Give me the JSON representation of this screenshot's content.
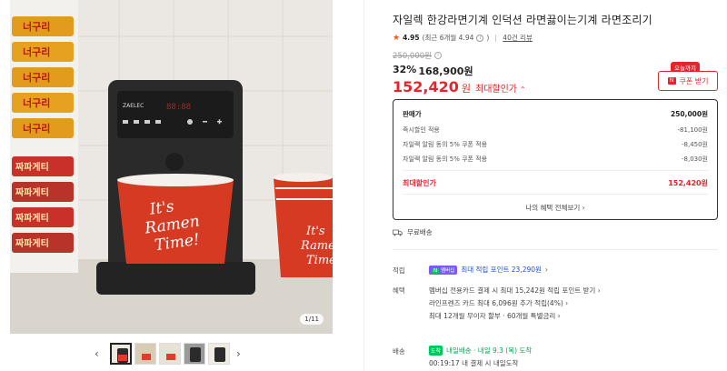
{
  "gallery": {
    "counter": "1/11",
    "prev_icon": "‹",
    "next_icon": "›",
    "thumbnail_count": 5,
    "image": {
      "noodle_brand_1": "너구리",
      "noodle_brand_2": "짜파게티",
      "machine_brand": "ZAELEC",
      "cup_text_1": "It's",
      "cup_text_2": "Ramen",
      "cup_text_3": "Time!"
    }
  },
  "product": {
    "title": "자일렉 한강라면기계 인덕션 라면끓이는기계 라면조리기",
    "rating": "4.95",
    "rating_detail": "(최근 6개월 4.94",
    "review_link": "40건 리뷰",
    "original_price": "250,000원",
    "discount_rate": "32%",
    "sale_price": "168,900원",
    "max_price": "152,420",
    "max_unit": "원",
    "max_label": "최대할인가",
    "coupon_badge": "오늘까지",
    "coupon_button": "쿠폰 받기"
  },
  "price_box": {
    "rows": [
      {
        "label": "판매가",
        "value": "250,000원"
      },
      {
        "label": "즉시할인 적용",
        "value": "-81,100원"
      },
      {
        "label": "자일렉 알림 동의 5% 쿠폰 적용",
        "value": "-8,450원"
      },
      {
        "label": "자일렉 알림 동의 5% 쿠폰 적용",
        "value": "-8,030원"
      }
    ],
    "max_label": "최대할인가",
    "max_value": "152,420원",
    "all_benefits": "나의 혜택 전체보기"
  },
  "shipping": "무료배송",
  "points": {
    "label": "적립",
    "badge": "멤버십",
    "text": "최대 적립 포인트 23,290원"
  },
  "benefits": {
    "label": "혜택",
    "lines": [
      "멤버십 전용카드 결제 시 최대 15,242원 적립 포인트 받기",
      "라인프렌즈 카드 최대 6,096원 추가 적립(4%)",
      "최대 12개월 무이자 할부 · 60개월 특별금리"
    ]
  },
  "delivery": {
    "label": "배송",
    "badge": "도착",
    "text": "내일배송 · 내일 9.3 (목) 도착",
    "detail": "00:19:17  내 결제 시 내일도착"
  },
  "colors": {
    "accent_red": "#e3262c",
    "star_orange": "#f15a22",
    "points_blue": "#1e4fd6",
    "delivery_green": "#03c75a"
  }
}
